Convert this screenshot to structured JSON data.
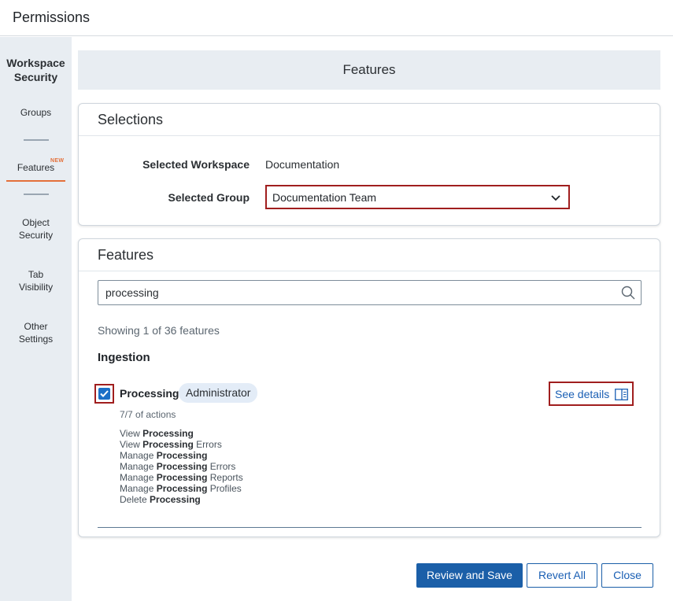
{
  "dialog": {
    "title": "Permissions"
  },
  "sidebar": {
    "heading": "Workspace Security",
    "items": [
      {
        "label": "Groups"
      },
      {
        "label": "Features",
        "badge": "NEW",
        "active": true
      },
      {
        "label": "Object Security"
      },
      {
        "label": "Tab Visibility"
      },
      {
        "label": "Other Settings"
      }
    ]
  },
  "page_header": {
    "title": "Features"
  },
  "selections": {
    "title": "Selections",
    "workspace_label": "Selected Workspace",
    "workspace_value": "Documentation",
    "group_label": "Selected Group",
    "group_value": "Documentation Team"
  },
  "features": {
    "title": "Features",
    "search_value": "processing",
    "showing": "Showing 1 of 36 features",
    "group_name": "Ingestion",
    "feature": {
      "name": "Processing",
      "role": "Administrator",
      "checked": true,
      "see_details": "See details",
      "actions_count": "7/7 of actions",
      "actions": [
        {
          "pre": "View ",
          "bold": "Processing",
          "post": ""
        },
        {
          "pre": "View ",
          "bold": "Processing",
          "post": " Errors"
        },
        {
          "pre": "Manage ",
          "bold": "Processing",
          "post": ""
        },
        {
          "pre": "Manage ",
          "bold": "Processing",
          "post": " Errors"
        },
        {
          "pre": "Manage ",
          "bold": "Processing",
          "post": " Reports"
        },
        {
          "pre": "Manage ",
          "bold": "Processing",
          "post": " Profiles"
        },
        {
          "pre": "Delete ",
          "bold": "Processing",
          "post": ""
        }
      ]
    }
  },
  "footer": {
    "review_save": "Review and Save",
    "revert_all": "Revert All",
    "close": "Close"
  },
  "colors": {
    "accent": "#1b5fa8",
    "highlight_border": "#a01e1e",
    "nav_active": "#e4703a",
    "sidebar_bg": "#e8edf2"
  }
}
